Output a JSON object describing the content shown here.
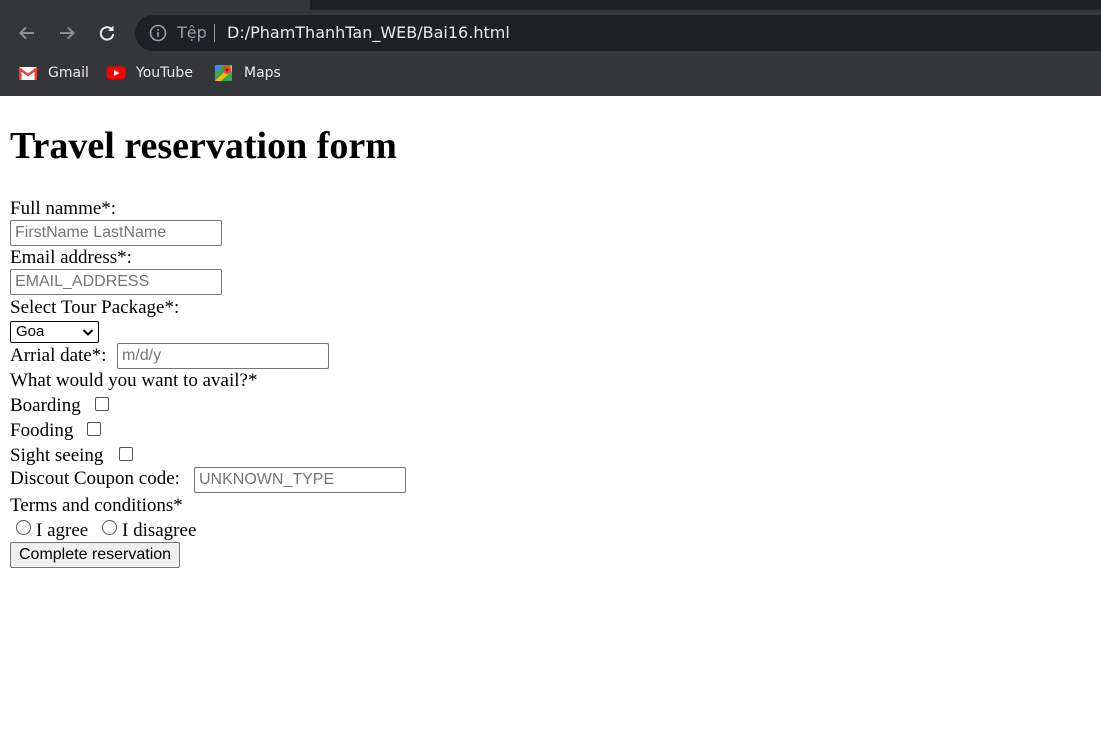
{
  "browser": {
    "omnibox": {
      "scheme_label": "Tệp",
      "url": "D:/PhamThanhTan_WEB/Bai16.html"
    },
    "bookmarks": [
      {
        "label": "Gmail",
        "icon": "gmail-icon"
      },
      {
        "label": "YouTube",
        "icon": "youtube-icon"
      },
      {
        "label": "Maps",
        "icon": "maps-icon"
      }
    ],
    "nav_icons": [
      "back-arrow-icon",
      "forward-arrow-icon",
      "reload-icon",
      "info-icon"
    ]
  },
  "form": {
    "title": "Travel reservation form",
    "full_name": {
      "label": "Full namme*:",
      "placeholder": "FirstName LastName",
      "value": ""
    },
    "email": {
      "label": "Email address*:",
      "placeholder": "EMAIL_ADDRESS",
      "value": ""
    },
    "tour": {
      "label": "Select Tour Package*:",
      "selected": "Goa"
    },
    "arrival": {
      "label": "Arrial date*:",
      "placeholder": "m/d/y"
    },
    "avail_question": "What would you want to avail?*",
    "options": [
      {
        "label": "Boarding",
        "checked": false
      },
      {
        "label": "Fooding",
        "checked": false
      },
      {
        "label": "Sight seeing",
        "checked": false
      }
    ],
    "coupon": {
      "label": "Discout Coupon code:",
      "placeholder": "UNKNOWN_TYPE"
    },
    "terms": {
      "label": "Terms and conditions*",
      "agree": "I agree",
      "disagree": "I disagree"
    },
    "submit_label": "Complete reservation"
  },
  "colors": {
    "chrome_bg": "#35363a",
    "omnibox_bg": "#202124",
    "chrome_text": "#e8eaed",
    "chrome_muted": "#9aa0a6"
  }
}
